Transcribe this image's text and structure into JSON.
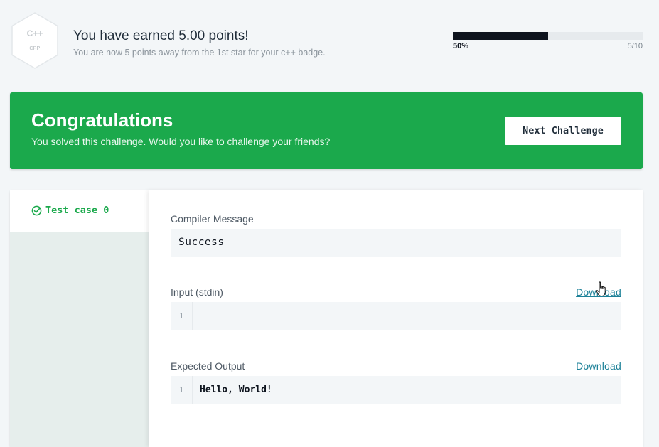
{
  "header": {
    "badge": {
      "lang": "C++",
      "code": "CPP"
    },
    "title": "You have earned 5.00 points!",
    "subtitle": "You are now 5 points away from the 1st star for your c++ badge.",
    "progress": {
      "fraction": 0.5,
      "percent_label": "50%",
      "count_label": "5/10"
    }
  },
  "banner": {
    "title": "Congratulations",
    "subtitle": "You solved this challenge. Would you like to challenge your friends?",
    "next_label": "Next Challenge"
  },
  "results": {
    "tabs": [
      {
        "label": "Test case 0",
        "status": "passed",
        "icon": "check-circle-icon"
      }
    ],
    "compiler_message": {
      "label": "Compiler Message",
      "value": "Success"
    },
    "input": {
      "label": "Input (stdin)",
      "download_label": "Download",
      "line_numbers": [
        "1"
      ],
      "lines": [
        ""
      ]
    },
    "expected": {
      "label": "Expected Output",
      "download_label": "Download",
      "line_numbers": [
        "1"
      ],
      "lines": [
        "Hello, World!"
      ]
    }
  },
  "colors": {
    "accent_green": "#1ba94c",
    "link": "#1c8198",
    "progress_fill": "#0e141e"
  }
}
